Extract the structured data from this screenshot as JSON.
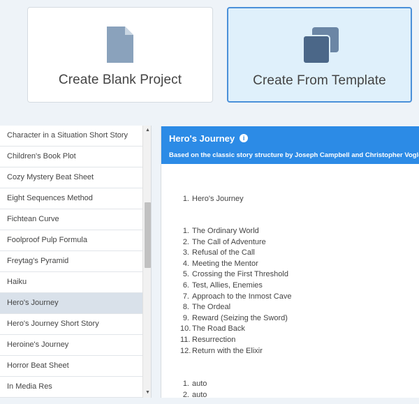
{
  "cards": {
    "blank": {
      "label": "Create Blank Project",
      "icon": "file-icon"
    },
    "template": {
      "label": "Create From Template",
      "icon": "copy-icon"
    }
  },
  "template_list": {
    "items": [
      "Character in a Situation Short Story",
      "Children's Book Plot",
      "Cozy Mystery Beat Sheet",
      "Eight Sequences Method",
      "Fichtean Curve",
      "Foolproof Pulp Formula",
      "Freytag's Pyramid",
      "Haiku",
      "Hero's Journey",
      "Hero's Journey Short Story",
      "Heroine's Journey",
      "Horror Beat Sheet",
      "In Media Res"
    ],
    "selected": "Hero's Journey"
  },
  "detail": {
    "title": "Hero's Journey",
    "subtitle": "Based on the classic story structure by Joseph Campbell and Christopher Vogler",
    "section_list": [
      {
        "num": "1.",
        "text": "Hero's Journey"
      }
    ],
    "steps": [
      {
        "num": "1.",
        "text": "The Ordinary World"
      },
      {
        "num": "2.",
        "text": "The Call of Adventure"
      },
      {
        "num": "3.",
        "text": "Refusal of the Call"
      },
      {
        "num": "4.",
        "text": "Meeting the Mentor"
      },
      {
        "num": "5.",
        "text": "Crossing the First Threshold"
      },
      {
        "num": "6.",
        "text": "Test, Allies, Enemies"
      },
      {
        "num": "7.",
        "text": "Approach to the Inmost Cave"
      },
      {
        "num": "8.",
        "text": "The Ordeal"
      },
      {
        "num": "9.",
        "text": "Reward (Seizing the Sword)"
      },
      {
        "num": "10.",
        "text": "The Road Back"
      },
      {
        "num": "11.",
        "text": "Resurrection"
      },
      {
        "num": "12.",
        "text": "Return with the Elixir"
      }
    ],
    "auto_list": [
      {
        "num": "1.",
        "text": "auto"
      },
      {
        "num": "2.",
        "text": "auto"
      }
    ]
  },
  "colors": {
    "accent": "#2c8be6",
    "selected_card_bg": "#dff0fb",
    "icon_blank": "#8aa2bc",
    "icon_template": "#4b6788"
  }
}
